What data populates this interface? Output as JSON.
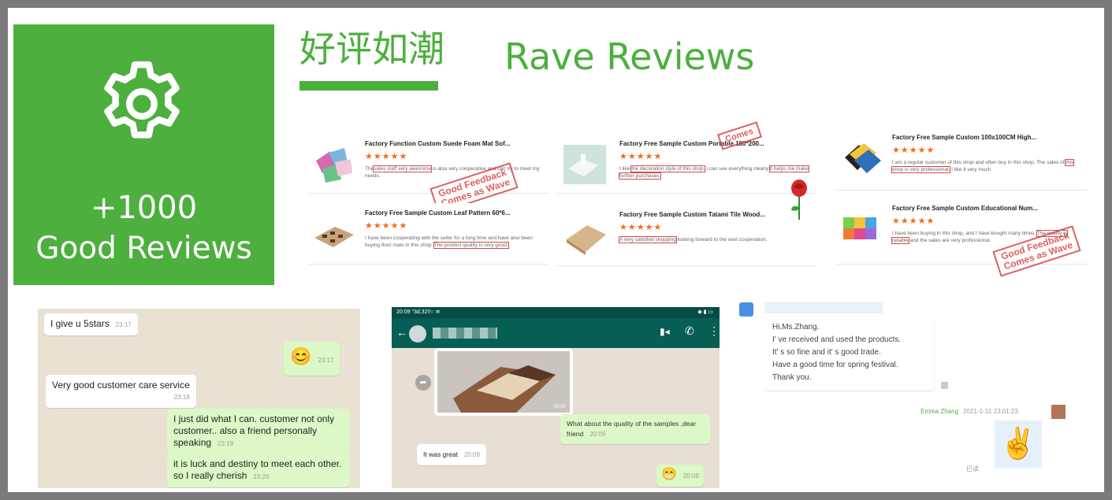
{
  "colors": {
    "brand_green": "#4caf3e",
    "stamp_red": "#d94545",
    "star_orange": "#f26b1d"
  },
  "promo": {
    "icon": "gear-icon",
    "count": "+1000",
    "label": "Good Reviews"
  },
  "header": {
    "title_cn": "好评如潮",
    "title_en": "Rave Reviews"
  },
  "stamps": {
    "line1": "Good Feedback",
    "line2": "Comes as Wave",
    "partial": "Comes"
  },
  "reviews": [
    {
      "product": "Factory Function Custom Suede Foam Mat Sof...",
      "stars": "★★★★★",
      "pre": "The",
      "hl": "sales staff very awesome",
      "post": "is also very cooperative and can try to meet my needs."
    },
    {
      "product": "Factory Free Sample Custom Portable 180*200...",
      "stars": "★★★★★",
      "pre": "I like",
      "hl": "the decoration style of this shop.",
      "post": "I can see everything clearly",
      "hl2": "it helps me make further purchases."
    },
    {
      "product": "Factory Free Sample Custom 100x100CM High...",
      "stars": "★★★★★",
      "pre": "I am a regular customer of this shop and often buy in this shop. The sales of",
      "hl": "this shop is very professional.",
      "post": "I like it very much."
    },
    {
      "product": "Factory Free Sample Custom Leaf Pattern 60*6...",
      "stars": "★★★★★",
      "pre": "I have been cooperating with the seller for a long time and have also been buying floor mats in this shop.",
      "hl": "The product quality is very good.",
      "post": ""
    },
    {
      "product": "Factory Free Sample Custom Tatami Tile Wood...",
      "stars": "★★★★★",
      "pre": "",
      "hl": "A very satisfied shopping",
      "post": "looking forward to the next cooperation."
    },
    {
      "product": "Factory Free Sample Custom Educational Num...",
      "stars": "★★★★★",
      "pre": "I have been buying in this shop, and I have bought many times.",
      "hl": "The quality is reliable",
      "post": "and the sales are very professional."
    }
  ],
  "chat1": {
    "m1": "I give u 5stars",
    "t1": "23:17",
    "emoji1": "😊",
    "t2": "23:17",
    "m3": "Very good customer care service",
    "t3": "23:18",
    "m4": "I just did what I can.  customer not only customer.. also a friend personally speaking",
    "t4": "23:19",
    "m5": "it is luck and destiny to meet each other.  so I really cherish",
    "t5": "23:20"
  },
  "chat2": {
    "status_time": "20:09 \"3d.32!!○ ≌",
    "photo_time": "20:09",
    "m1": "What about the quality of the samples ,dear friend",
    "t1": "20:09",
    "m2": "It was great",
    "t2": "20:09",
    "emoji": "😁",
    "t3": "20:09"
  },
  "chat3": {
    "msg": "Hi,Ms.Zhang.\nI' ve received and used the products.\nIt' s so fine and it' s good trade.\nHave a good time for spring festival.\nThank you.",
    "sender": "Emma Zhang",
    "timestamp": "2021-1-31 23:01:23",
    "emoji": "✌️",
    "status": "已读"
  }
}
